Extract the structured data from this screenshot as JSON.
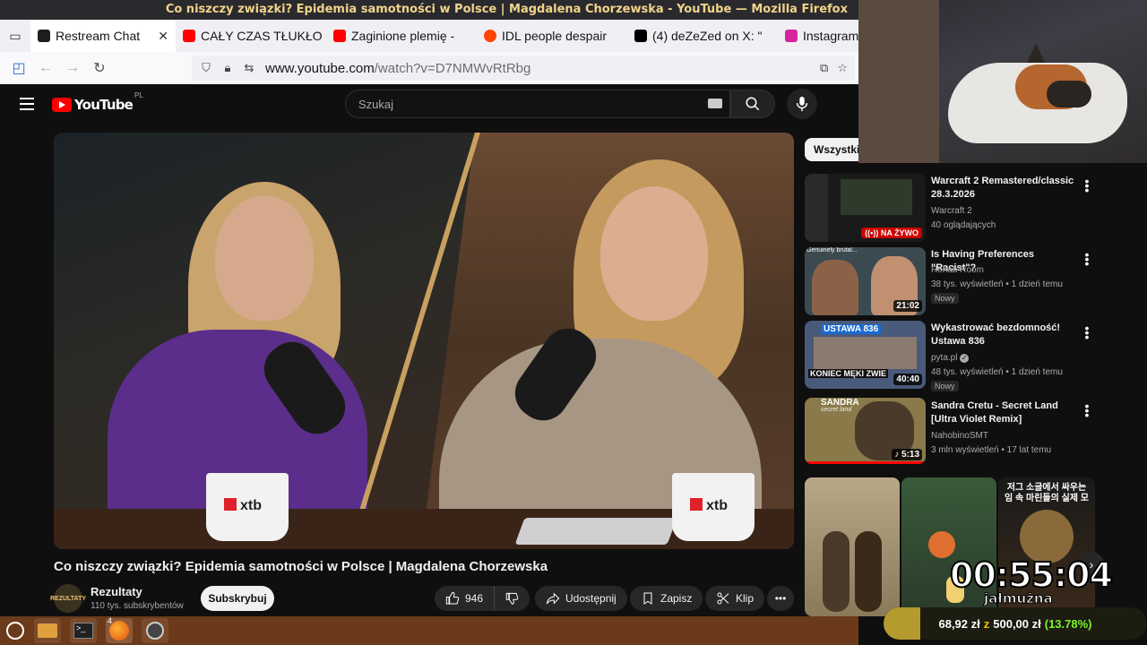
{
  "window_title": "Co niszczy związki? Epidemia samotności w Polsce | Magdalena Chorzewska - YouTube — Mozilla Firefox",
  "tabs": [
    {
      "label": "Restream Chat",
      "color": "#1e1e1e",
      "active": true
    },
    {
      "label": "CAŁY CZAS TŁUKŁO",
      "color": "#ff0000"
    },
    {
      "label": "Zaginione plemię -",
      "color": "#ff0000"
    },
    {
      "label": "IDL people despair",
      "color": "#ff4500"
    },
    {
      "label": "(4) deZeZed on X: \"",
      "color": "#000000"
    },
    {
      "label": "Instagram",
      "color": "#d6249f"
    }
  ],
  "url": {
    "host": "www.youtube.com",
    "path": "/watch?v=D7NMWvRtRbg"
  },
  "yt": {
    "logo_text": "YouTube",
    "country": "PL",
    "search_placeholder": "Szukaj"
  },
  "video": {
    "title": "Co niszczy związki? Epidemia samotności w Polsce | Magdalena Chorzewska",
    "mug_brand": "xtb",
    "channel": {
      "name": "Rezultaty",
      "subs": "110 tys. subskrybentów",
      "avatar_text": "REZULTATY"
    },
    "subscribe": "Subskrybuj",
    "likes": "946",
    "share": "Udostępnij",
    "save": "Zapisz",
    "clip": "Klip"
  },
  "sidebar": {
    "chip": "Wszystkie",
    "items": [
      {
        "title": "Warcraft 2 Remastered/classic 28.3.2026",
        "channel": "Warcraft 2",
        "meta": "40 oglądających",
        "badge_live": "NA ŻYWO"
      },
      {
        "title": "Is Having Preferences \"Racist\"?",
        "channel": "Rehab Room",
        "meta": "38 tys. wyświetleń • 1 dzień temu",
        "new": "Nowy",
        "duration": "21:02",
        "thumb_caption": "Genuinely brutal..."
      },
      {
        "title": "Wykastrować bezdomność! Ustawa 836",
        "channel": "pyta.pl",
        "meta": "48 tys. wyświetleń • 1 dzień temu",
        "new": "Nowy",
        "duration": "40:40",
        "thumb_top": "USTAWA 836",
        "thumb_bottom": "KONIEC MĘKI ZWIE"
      },
      {
        "title": "Sandra Cretu - Secret Land [Ultra Violet Remix]",
        "channel": "NahobinoSMT",
        "meta": "3 mln wyświetleń • 17 lat temu",
        "duration": "5:13",
        "thumb_top": "SANDRA",
        "thumb_sub": "secret land"
      }
    ],
    "shorts_caption": "저그 소굴에서 싸우는 임 속 마린들의 실제 모"
  },
  "overlay": {
    "timer": "00:55:04",
    "timer_label": "jałmużna",
    "goal_current": "68,92 zł",
    "goal_sep": "z",
    "goal_target": "500,00 zł",
    "goal_pct": "(13.78%)",
    "goal_fraction": 0.1378
  },
  "taskbar": {
    "firefox_badge": "4"
  }
}
